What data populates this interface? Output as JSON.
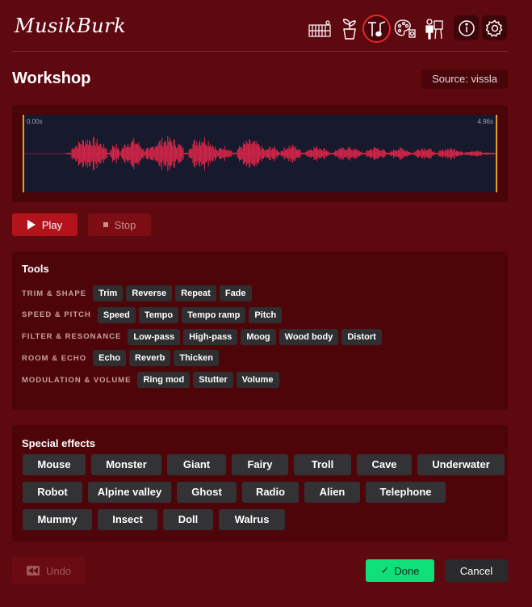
{
  "app": {
    "title": "MusikBurk"
  },
  "nav": {
    "icons": [
      "library-icon",
      "plant-icon",
      "workshop-icon",
      "palette-icon",
      "studio-icon",
      "info-icon",
      "settings-icon"
    ],
    "active": "workshop-icon"
  },
  "page": {
    "title": "Workshop",
    "source_label": "Source: vissla"
  },
  "waveform": {
    "start_time": "0.00s",
    "end_time": "4.96s",
    "wave_color": "#e0264a",
    "marker_color": "#e6a020"
  },
  "transport": {
    "play_label": "Play",
    "stop_label": "Stop"
  },
  "tools": {
    "title": "Tools",
    "categories": [
      {
        "label": "TRIM & SHAPE",
        "items": [
          "Trim",
          "Reverse",
          "Repeat",
          "Fade"
        ]
      },
      {
        "label": "SPEED & PITCH",
        "items": [
          "Speed",
          "Tempo",
          "Tempo ramp",
          "Pitch"
        ]
      },
      {
        "label": "FILTER & RESONANCE",
        "items": [
          "Low-pass",
          "High-pass",
          "Moog",
          "Wood body",
          "Distort"
        ]
      },
      {
        "label": "ROOM & ECHO",
        "items": [
          "Echo",
          "Reverb",
          "Thicken"
        ]
      },
      {
        "label": "MODULATION & VOLUME",
        "items": [
          "Ring mod",
          "Stutter",
          "Volume"
        ]
      }
    ]
  },
  "special_effects": {
    "title": "Special effects",
    "rows": [
      [
        "Mouse",
        "Monster",
        "Giant",
        "Fairy",
        "Troll",
        "Cave",
        "Underwater"
      ],
      [
        "Robot",
        "Alpine valley",
        "Ghost",
        "Radio",
        "Alien",
        "Telephone"
      ],
      [
        "Mummy",
        "Insect",
        "Doll",
        "Walrus"
      ]
    ]
  },
  "footer": {
    "undo_label": "Undo",
    "done_label": "Done",
    "cancel_label": "Cancel"
  },
  "colors": {
    "background": "#5e0810",
    "accent": "#b3141c",
    "done": "#10e07a"
  }
}
